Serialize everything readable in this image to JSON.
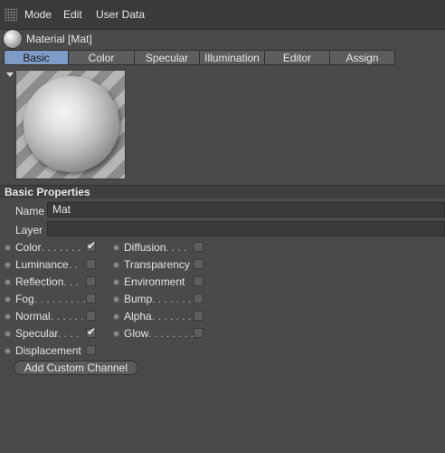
{
  "menu": [
    "Mode",
    "Edit",
    "User Data"
  ],
  "material_title": "Material [Mat]",
  "tabs": [
    {
      "label": "Basic",
      "active": true
    },
    {
      "label": "Color",
      "active": false
    },
    {
      "label": "Specular",
      "active": false
    },
    {
      "label": "Illumination",
      "active": false
    },
    {
      "label": "Editor",
      "active": false
    },
    {
      "label": "Assign",
      "active": false
    }
  ],
  "section_title": "Basic Properties",
  "name_label": "Name",
  "name_value": "Mat",
  "layer_label": "Layer",
  "layer_value": "",
  "channels_left": [
    {
      "label": "Color",
      "dots": " . . . . . . .",
      "checked": true
    },
    {
      "label": "Luminance",
      "dots": " . .",
      "checked": false
    },
    {
      "label": "Reflection",
      "dots": " . . .",
      "checked": false
    },
    {
      "label": "Fog",
      "dots": " . . . . . . . . .",
      "checked": false
    },
    {
      "label": "Normal",
      "dots": " . . . . . .",
      "checked": false
    },
    {
      "label": "Specular",
      "dots": " . . . .",
      "checked": true
    },
    {
      "label": "Displacement",
      "dots": "",
      "checked": false
    }
  ],
  "channels_right": [
    {
      "label": "Diffusion",
      "dots": " . . . .",
      "checked": false
    },
    {
      "label": "Transparency",
      "dots": "",
      "checked": false
    },
    {
      "label": "Environment",
      "dots": "",
      "checked": false
    },
    {
      "label": "Bump",
      "dots": " . . . . . . .",
      "checked": false
    },
    {
      "label": "Alpha",
      "dots": " . . . . . . . .",
      "checked": false
    },
    {
      "label": "Glow",
      "dots": " . . . . . . . .",
      "checked": false
    }
  ],
  "add_channel_label": "Add Custom Channel",
  "colors": {
    "active_tab": "#7f9cc8",
    "background": "#4a4a4a"
  }
}
